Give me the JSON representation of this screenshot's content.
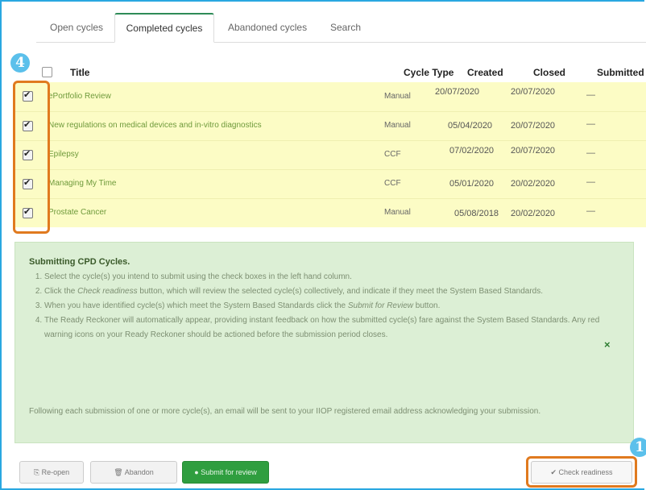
{
  "tabs": [
    {
      "label": "Open cycles"
    },
    {
      "label": "Completed cycles"
    },
    {
      "label": "Abandoned cycles"
    },
    {
      "label": "Search"
    }
  ],
  "badges": {
    "left": "4",
    "right": "1"
  },
  "table": {
    "headers": {
      "title": "Title",
      "cycle_type": "Cycle Type",
      "created": "Created",
      "closed": "Closed",
      "submitted": "Submitted"
    },
    "rows": [
      {
        "title": "ePortfolio Review",
        "cycle_type": "Manual",
        "created": "20/07/2020",
        "closed": "20/07/2020",
        "submitted": "—",
        "checked": true
      },
      {
        "title": "New regulations on medical devices and in-vitro diagnostics",
        "cycle_type": "Manual",
        "created": "05/04/2020",
        "closed": "20/07/2020",
        "submitted": "—",
        "checked": true
      },
      {
        "title": "Epilepsy",
        "cycle_type": "CCF",
        "created": "07/02/2020",
        "closed": "20/07/2020",
        "submitted": "—",
        "checked": true
      },
      {
        "title": "Managing My Time",
        "cycle_type": "CCF",
        "created": "05/01/2020",
        "closed": "20/02/2020",
        "submitted": "—",
        "checked": true
      },
      {
        "title": "Prostate Cancer",
        "cycle_type": "Manual",
        "created": "05/08/2018",
        "closed": "20/02/2020",
        "submitted": "—",
        "checked": true
      }
    ]
  },
  "info": {
    "title": "Submitting CPD Cycles.",
    "step1": "Select the cycle(s) you intend to submit using the check boxes in the left hand column.",
    "step2_pre": "Click the ",
    "step2_em": "Check readiness",
    "step2_post": " button, which will review the selected cycle(s) collectively, and indicate if they meet the System Based Standards.",
    "step3_pre": "When you have identified cycle(s) which meet the System Based Standards click the ",
    "step3_em": "Submit for Review",
    "step3_post": " button.",
    "step4": "The Ready Reckoner will automatically appear, providing instant feedback on how the submitted cycle(s) fare against the System Based Standards. Any red warning icons on your Ready Reckoner should be actioned before the submission period closes.",
    "footer": "Following each submission of one or more cycle(s), an email will be sent to your IIOP registered email address acknowledging your submission.",
    "close": "×"
  },
  "buttons": {
    "reopen": "Re-open",
    "abandon": "Abandon",
    "submit": "Submit for review",
    "check": "Check readiness"
  }
}
